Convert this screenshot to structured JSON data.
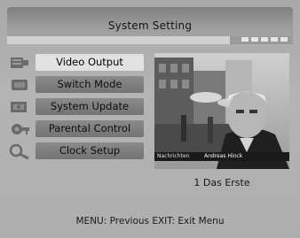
{
  "title": "System Setting",
  "progress": 0.78,
  "indicator_dots": 5,
  "menu": {
    "items": [
      {
        "label": "Video Output",
        "icon": "video-output-icon",
        "selected": true
      },
      {
        "label": "Switch Mode",
        "icon": "switch-mode-icon",
        "selected": false
      },
      {
        "label": "System Update",
        "icon": "system-update-icon",
        "selected": false
      },
      {
        "label": "Parental Control",
        "icon": "parental-control-icon",
        "selected": false
      },
      {
        "label": "Clock Setup",
        "icon": "clock-setup-icon",
        "selected": false
      }
    ]
  },
  "preview": {
    "channel_number": "1",
    "channel_name": "Das Erste",
    "caption_left": "Nachrichten",
    "caption_right": "Andreas Hinck"
  },
  "footer": {
    "menu_key": "MENU:",
    "menu_action": "Previous",
    "exit_key": "EXIT:",
    "exit_action": "Exit Menu"
  },
  "colors": {
    "background": "#b0b0b0",
    "titlebar": "#8f8f8f",
    "menu_item": "#7f7f7f",
    "menu_item_selected": "#e2e2e2",
    "text": "#141414"
  }
}
